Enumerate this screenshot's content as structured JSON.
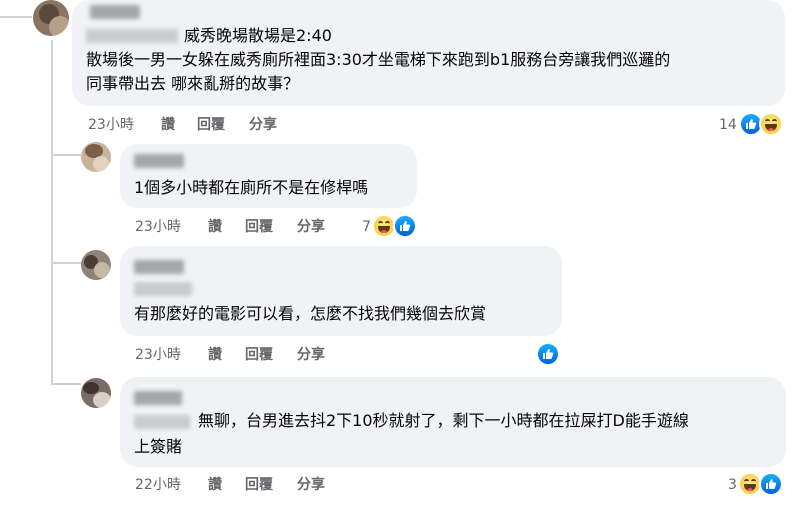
{
  "comments": [
    {
      "line1": "威秀晚場散場是2:40",
      "line2": "散場後一男一女躲在威秀廁所裡面3:30才坐電梯下來跑到b1服務台旁讓我們巡邏的",
      "line3": "同事帶出去 哪來亂掰的故事？",
      "time": "23小時",
      "read": "讚",
      "reply": "回覆",
      "share": "分享",
      "count": "14",
      "reactions": [
        "like-icon",
        "haha-icon"
      ]
    },
    {
      "line1": "1個多小時都在廁所不是在修桿嗎",
      "time": "23小時",
      "read": "讚",
      "reply": "回覆",
      "share": "分享",
      "count": "7",
      "reactions": [
        "haha-icon",
        "like-icon"
      ]
    },
    {
      "line1": "有那麼好的電影可以看，怎麼不找我們幾個去欣賞",
      "time": "23小時",
      "read": "讚",
      "reply": "回覆",
      "share": "分享",
      "reactions": [
        "like-icon"
      ]
    },
    {
      "line1": "無聊，台男進去抖2下10秒就射了，剩下一小時都在拉屎打D能手遊線",
      "line2": "上簽賭",
      "time": "22小時",
      "read": "讚",
      "reply": "回覆",
      "share": "分享",
      "count": "3",
      "reactions": [
        "haha-icon",
        "like-icon"
      ]
    }
  ],
  "colors": {
    "bubble": "#f0f2f5",
    "text": "#050505",
    "meta": "#65676b",
    "like": "#1877f2",
    "haha": "#f7c62e"
  }
}
